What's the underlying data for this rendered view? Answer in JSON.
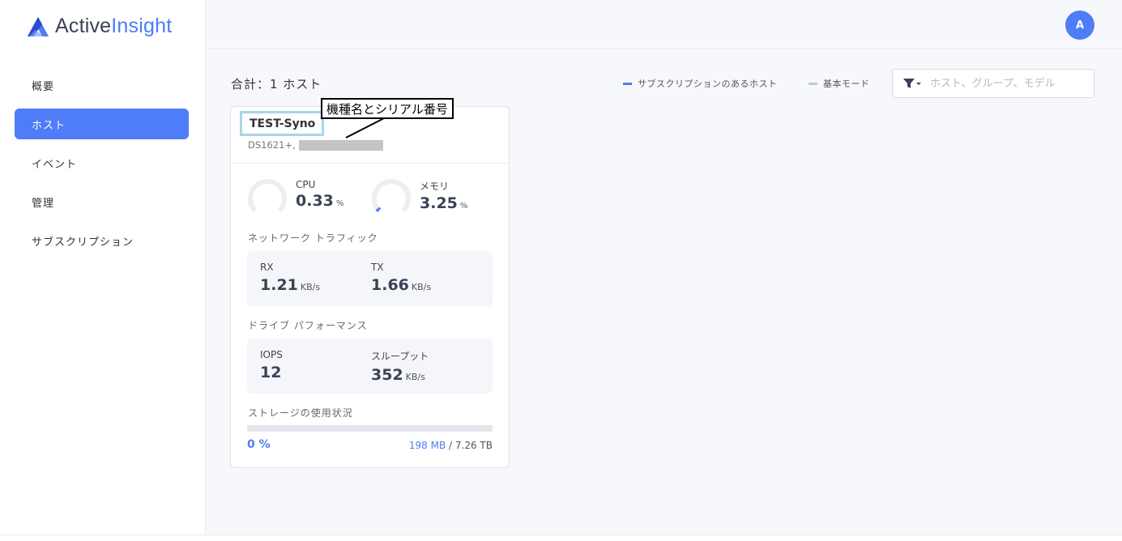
{
  "brand": {
    "name_part1": "Active",
    "name_part2": "Insight",
    "accent": "#4f7cf7"
  },
  "sidebar": {
    "items": [
      {
        "label": "概要",
        "active": false
      },
      {
        "label": "ホスト",
        "active": true
      },
      {
        "label": "イベント",
        "active": false
      },
      {
        "label": "管理",
        "active": false
      },
      {
        "label": "サブスクリプション",
        "active": false
      }
    ]
  },
  "header": {
    "avatar_initial": "A"
  },
  "main": {
    "total_label": "合計：1 ホスト",
    "legend": [
      {
        "label": "サブスクリプションのあるホスト",
        "color": "#4f7cf7"
      },
      {
        "label": "基本モード",
        "color": "#c5c8d8"
      }
    ],
    "search": {
      "placeholder": "ホスト、グループ、モデル",
      "icon": "filter-icon"
    }
  },
  "host_card": {
    "name": "TEST-Syno",
    "model_prefix": "DS1621+,",
    "cpu": {
      "label": "CPU",
      "value": "0.33",
      "unit": "%",
      "fraction": 0.0033
    },
    "memory": {
      "label": "メモリ",
      "value": "3.25",
      "unit": "%",
      "fraction": 0.0325
    },
    "network": {
      "title": "ネットワーク トラフィック",
      "rx": {
        "label": "RX",
        "value": "1.21",
        "unit": "KB/s"
      },
      "tx": {
        "label": "TX",
        "value": "1.66",
        "unit": "KB/s"
      }
    },
    "drive": {
      "title": "ドライブ パフォーマンス",
      "iops": {
        "label": "IOPS",
        "value": "12"
      },
      "throughput": {
        "label": "スループット",
        "value": "352",
        "unit": "KB/s"
      }
    },
    "storage": {
      "title": "ストレージの使用状況",
      "percent": "0 %",
      "used": "198 MB",
      "separator": " / ",
      "total": "7.26 TB",
      "fraction": 0.0
    }
  },
  "annotation": {
    "label": "機種名とシリアル番号"
  }
}
